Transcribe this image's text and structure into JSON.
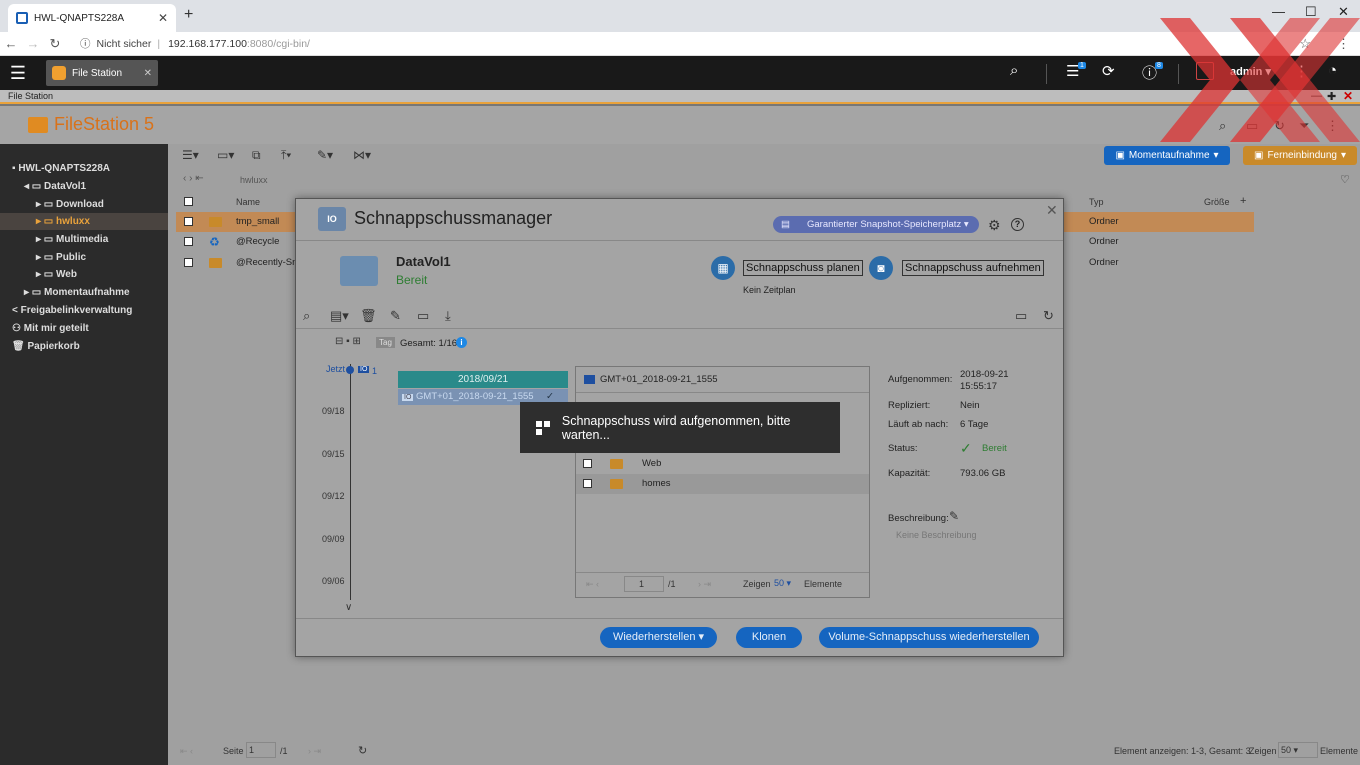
{
  "browser": {
    "tab_title": "HWL-QNAPTS228A",
    "security": "Nicht sicher",
    "url_host": "192.168.177.100",
    "url_rest": ":8080/cgi-bin/"
  },
  "qnap": {
    "app_tab": "File Station",
    "info_badge": "1",
    "notif_badge": "8",
    "user": "admin",
    "app_label": "File Station"
  },
  "app": {
    "logo_main": "FileStation",
    "logo_num": " 5",
    "moment_button": "Momentaufnahme",
    "remote_button": "Ferneinbindung",
    "path": "hwluxx"
  },
  "sidebar": {
    "host": "HWL-QNAPTS228A",
    "volume": "DataVol1",
    "items": [
      "Download",
      "hwluxx",
      "Multimedia",
      "Public",
      "Web"
    ],
    "snapshot": "Momentaufnahme",
    "share_links": "Freigabelinkverwaltung",
    "shared_with_me": "Mit mir geteilt",
    "recycle": "Papierkorb"
  },
  "filelist": {
    "columns": {
      "name": "Name",
      "type": "Typ",
      "size": "Größe"
    },
    "rows": [
      {
        "name": "tmp_small",
        "type": "Ordner"
      },
      {
        "name": "@Recycle",
        "type": "Ordner"
      },
      {
        "name": "@Recently-Snap",
        "type": "Ordner"
      }
    ]
  },
  "statusbar": {
    "page_label": "Seite",
    "page": "1",
    "page_total": "/1",
    "summary": "Element anzeigen: 1-3, Gesamt: 3",
    "show_label": "Zeigen",
    "per_page": "50",
    "elements": "Elemente"
  },
  "dialog": {
    "title": "Schnappschussmanager",
    "storage_button": "Garantierter Snapshot-Speicherplatz",
    "volume_name": "DataVol1",
    "volume_status": "Bereit",
    "plan_button": "Schnappschuss planen",
    "take_button": "Schnappschuss aufnehmen",
    "schedule": "Kein Zeitplan",
    "timeline": {
      "tag": "Tag",
      "total": "Gesamt: 1/16",
      "now": "Jetzt",
      "count": "1",
      "dates": [
        "09/18",
        "09/15",
        "09/12",
        "09/09",
        "09/06"
      ],
      "day": "2018/09/21",
      "snapshot": "GMT+01_2018-09-21_1555"
    },
    "files": {
      "header": "GMT+01_2018-09-21_1555",
      "rows": [
        "Web",
        "homes"
      ],
      "page": "1",
      "page_total": "/1",
      "show_label": "Zeigen",
      "per_page": "50",
      "elements": "Elemente"
    },
    "props": {
      "taken_label": "Aufgenommen:",
      "taken_date": "2018-09-21",
      "taken_time": "15:55:17",
      "replicated_label": "Repliziert:",
      "replicated": "Nein",
      "expires_label": "Läuft ab nach:",
      "expires": "6 Tage",
      "status_label": "Status:",
      "status": "Bereit",
      "capacity_label": "Kapazität:",
      "capacity": "793.06 GB",
      "desc_label": "Beschreibung:",
      "desc": "Keine Beschreibung"
    },
    "restore_button": "Wiederherstellen",
    "clone_button": "Klonen",
    "volume_restore_button": "Volume-Schnappschuss wiederherstellen"
  },
  "toast": "Schnappschuss wird aufgenommen, bitte warten...",
  "colors": {
    "accent": "#1565c0",
    "orange": "#e9a23b",
    "ready": "#2e7d32"
  }
}
